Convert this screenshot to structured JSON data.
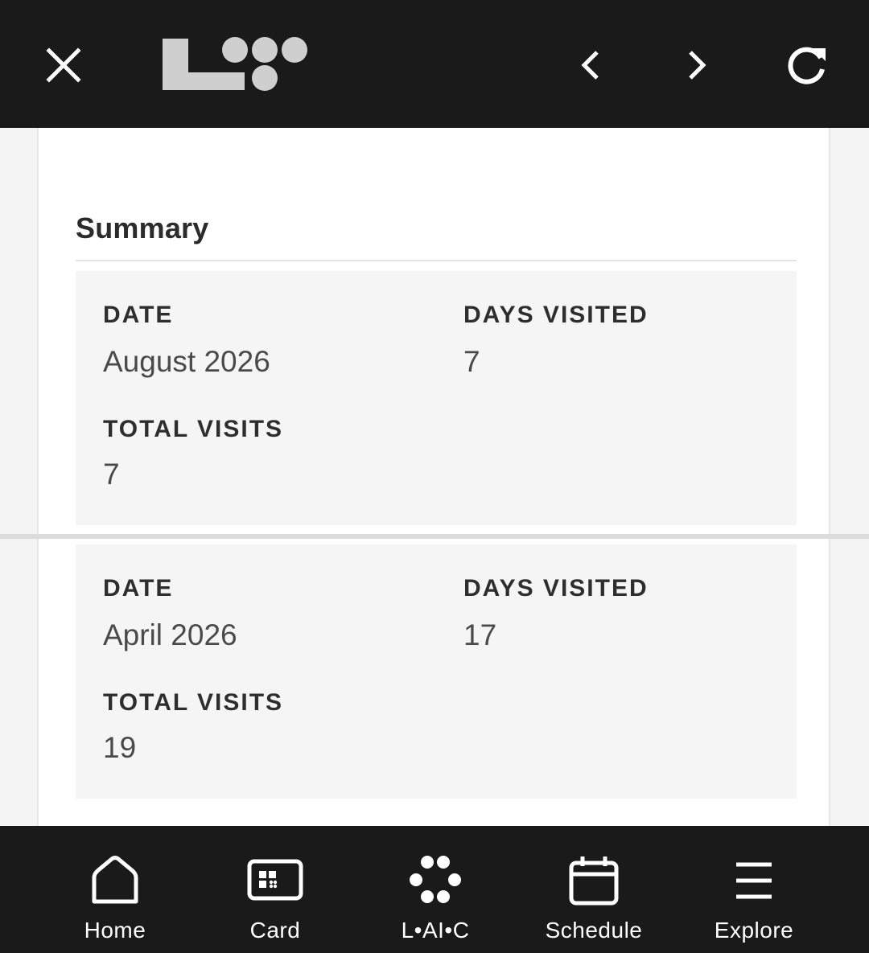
{
  "header": {
    "close_icon": "close-icon",
    "logo": "laic-logo",
    "back_icon": "chevron-left-icon",
    "forward_icon": "chevron-right-icon",
    "reload_icon": "reload-icon"
  },
  "summary": {
    "title": "Summary",
    "entries": [
      {
        "date_label": "DATE",
        "date_value": "August 2026",
        "days_label": "DAYS VISITED",
        "days_value": "7",
        "total_label": "TOTAL VISITS",
        "total_value": "7"
      },
      {
        "date_label": "DATE",
        "date_value": "April 2026",
        "days_label": "DAYS VISITED",
        "days_value": "17",
        "total_label": "TOTAL VISITS",
        "total_value": "19"
      }
    ]
  },
  "nav": {
    "items": [
      {
        "label": "Home",
        "icon": "home-icon"
      },
      {
        "label": "Card",
        "icon": "card-icon"
      },
      {
        "label": "L•AI•C",
        "icon": "laic-dots-icon"
      },
      {
        "label": "Schedule",
        "icon": "calendar-icon"
      },
      {
        "label": "Explore",
        "icon": "menu-icon"
      }
    ]
  },
  "colors": {
    "bar_bg": "#1a1a1a",
    "page_bg": "#f4f4f4",
    "card_bg": "#f5f5f5",
    "logo_gray": "#cfcfcf"
  }
}
